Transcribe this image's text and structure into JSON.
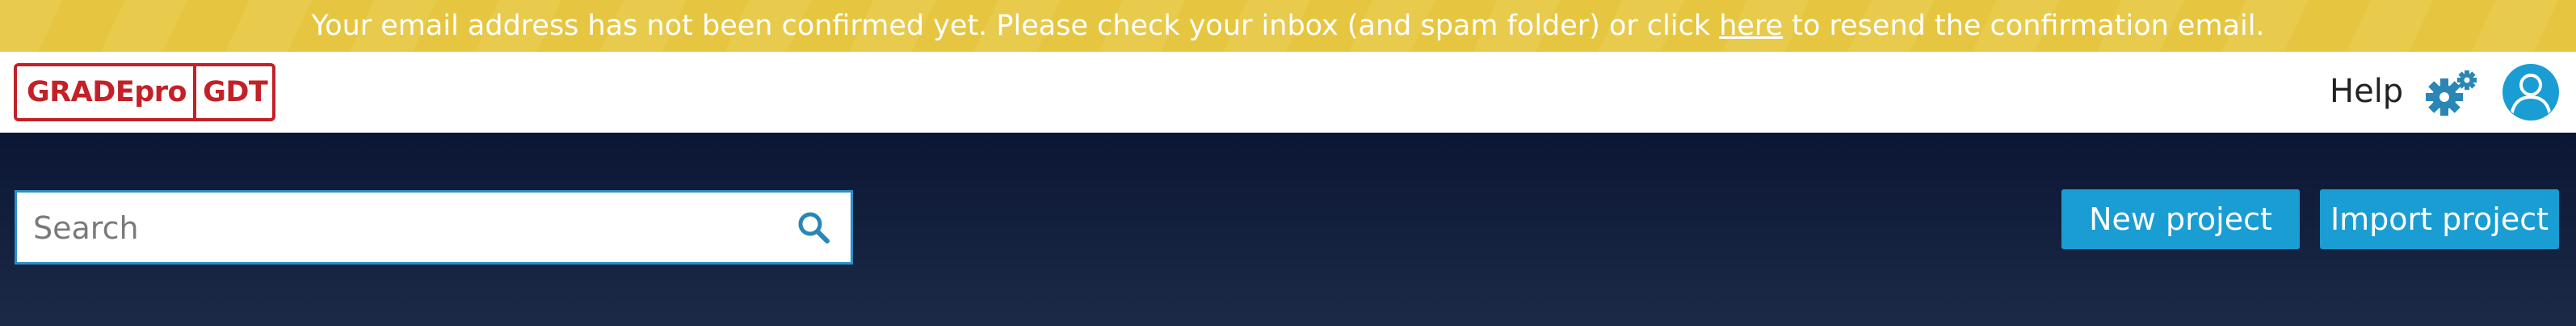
{
  "banner": {
    "text_before": "Your email address has not been confirmed yet. Please check your inbox (and spam folder) or click ",
    "link_text": "here",
    "text_after": " to resend the confirmation email.",
    "background_color": "#e6c640"
  },
  "header": {
    "logo": {
      "part1": "GRADEpro",
      "part2": "GDT",
      "color": "#c32127"
    },
    "help_label": "Help",
    "settings_icon": "gears-icon",
    "user_icon": "user-avatar-icon"
  },
  "main": {
    "search": {
      "placeholder": "Search",
      "value": "",
      "icon": "search-icon"
    },
    "buttons": {
      "new_project": "New project",
      "import_project": "Import project"
    },
    "accent_color": "#1a9dd3"
  }
}
